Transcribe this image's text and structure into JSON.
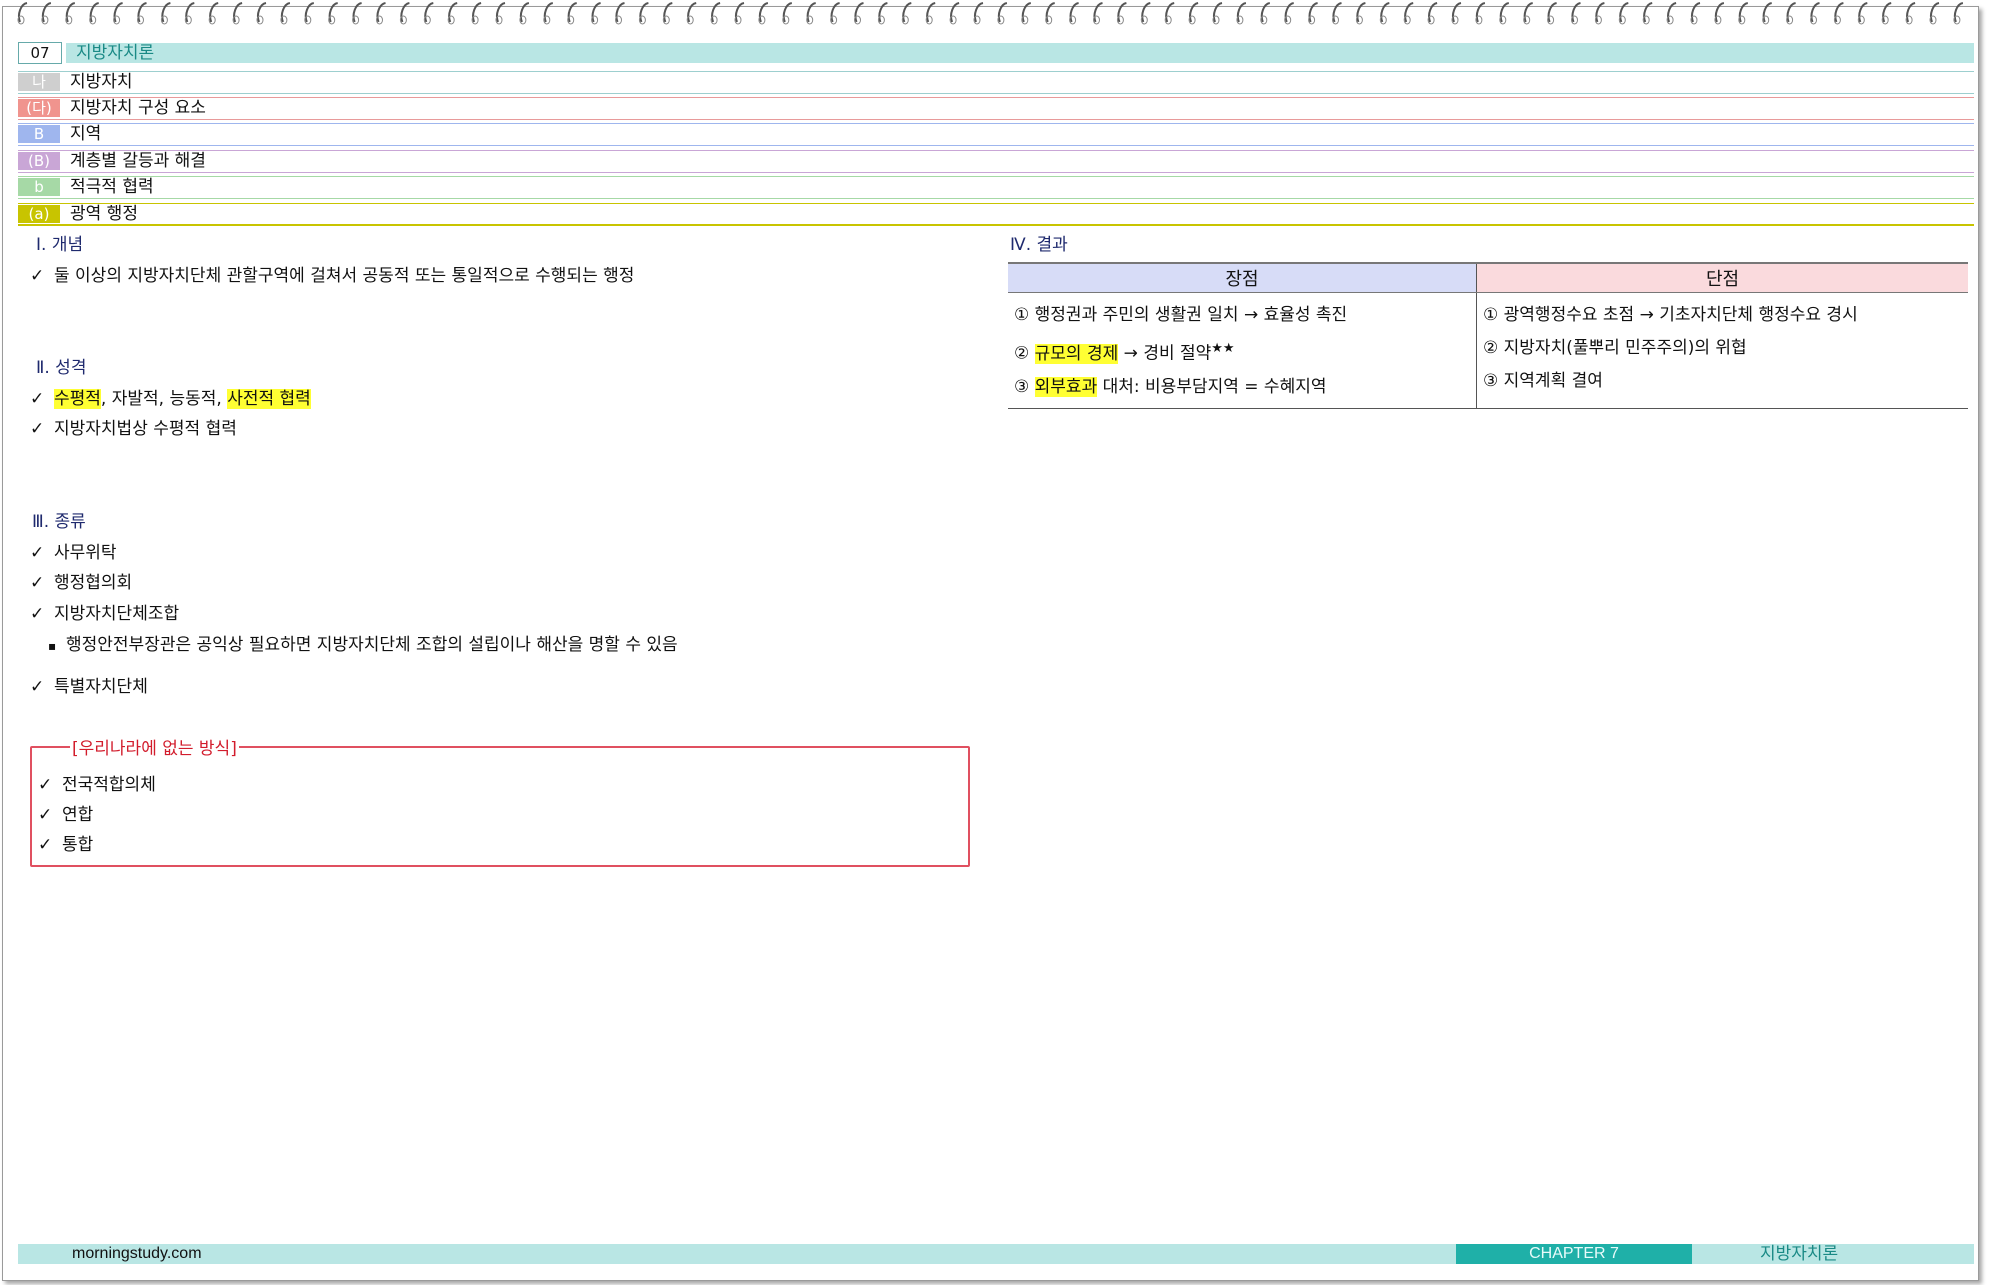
{
  "header": {
    "chapter_num": "07",
    "chapter_title": "지방자치론",
    "levels": [
      {
        "tag": "나",
        "text": "지방자치",
        "tag_color": "#cfcfcf",
        "line_color": "#9dcfcf"
      },
      {
        "tag": "(다)",
        "text": "지방자치 구성 요소",
        "tag_color": "#f0948e",
        "line_color": "#e89a9a"
      },
      {
        "tag": "B",
        "text": "지역",
        "tag_color": "#9fb6ee",
        "line_color": "#9fb6ee"
      },
      {
        "tag": "(B)",
        "text": "계층별 갈등과 해결",
        "tag_color": "#c9a6d6",
        "line_color": "#c9a6d6"
      },
      {
        "tag": "b",
        "text": "적극적 협력",
        "tag_color": "#a6d9a6",
        "line_color": "#a6d9a6"
      },
      {
        "tag": "(a)",
        "text": "광역 행정",
        "tag_color": "#c8c400",
        "line_color": "#c8c400"
      }
    ]
  },
  "sections": {
    "concept": {
      "heading": "Ⅰ. 개념",
      "items": [
        "둘 이상의 지방자치단체 관할구역에 걸쳐서 공동적 또는 통일적으로 수행되는 행정"
      ]
    },
    "nature": {
      "heading": "Ⅱ. 성격",
      "line1": {
        "hl1": "수평적",
        "mid": ", 자발적, 능동적, ",
        "hl2": "사전적 협력"
      },
      "line2": "지방자치법상 수평적 협력"
    },
    "types": {
      "heading": "Ⅲ. 종류",
      "items": [
        "사무위탁",
        "행정협의회",
        "지방자치단체조합"
      ],
      "sub_note": "행정안전부장관은 공익상 필요하면 지방자치단체 조합의 설립이나 해산을 명할 수 있음",
      "last": "특별자치단체"
    },
    "not_in_korea": {
      "title": "[우리나라에 없는 방식]",
      "items": [
        "전국적합의체",
        "연합",
        "통합"
      ]
    },
    "results": {
      "heading": "Ⅳ. 결과",
      "pros_header": "장점",
      "cons_header": "단점",
      "pros": {
        "p1": "① 행정권과 주민의 생활권 일치  → 효율성 촉진",
        "p2_num": "② ",
        "p2_hl": "규모의 경제",
        "p2_rest": " → 경비 절약",
        "p2_stars": "★★",
        "p3_num": "③ ",
        "p3_hl": "외부효과",
        "p3_rest": " 대처: 비용부담지역 = 수혜지역"
      },
      "cons": [
        "① 광역행정수요 초점 → 기초자치단체 행정수요 경시",
        "② 지방자치(풀뿌리 민주주의)의 위협",
        "③ 지역계획 결여"
      ],
      "pros_header_color": "#d7dcf7",
      "cons_header_color": "#fadadd"
    }
  },
  "footer": {
    "site": "morningstudy.com",
    "chapter": "CHAPTER  7",
    "title": "지방자치론"
  },
  "check_mark": "✓",
  "bullet": "▪"
}
